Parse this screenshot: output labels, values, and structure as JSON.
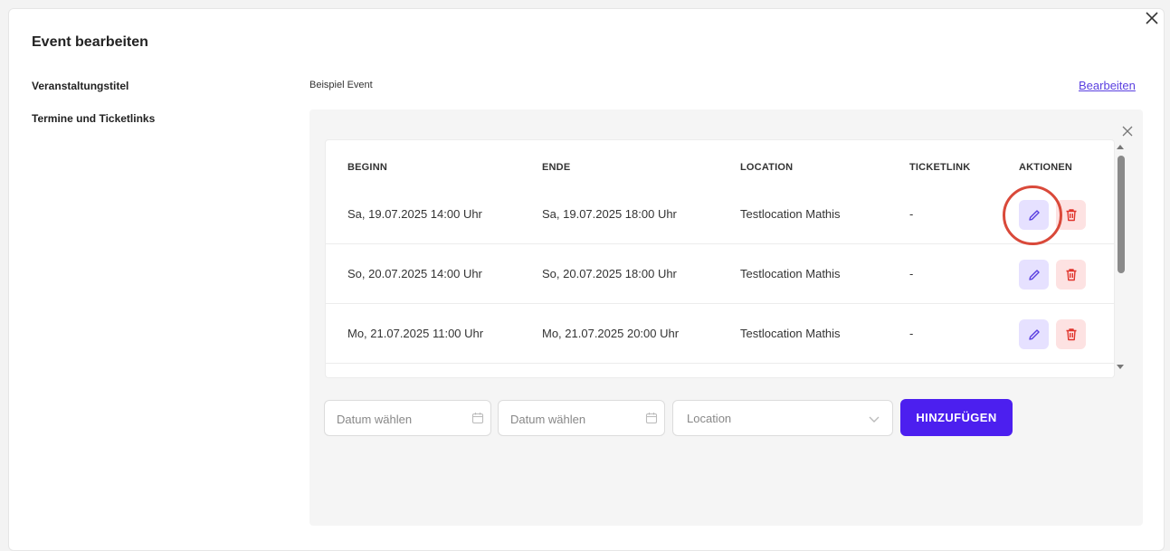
{
  "modal": {
    "title": "Event bearbeiten",
    "title_label": "Veranstaltungstitel",
    "title_value": "Beispiel Event",
    "edit_link": "Bearbeiten",
    "dates_label": "Termine und Ticketlinks"
  },
  "table": {
    "headers": [
      "BEGINN",
      "ENDE",
      "LOCATION",
      "TICKETLINK",
      "AKTIONEN"
    ],
    "rows": [
      {
        "start": "Sa, 19.07.2025 14:00 Uhr",
        "end": "Sa, 19.07.2025 18:00 Uhr",
        "location": "Testlocation Mathis",
        "ticketlink": "-"
      },
      {
        "start": "So, 20.07.2025 14:00 Uhr",
        "end": "So, 20.07.2025 18:00 Uhr",
        "location": "Testlocation Mathis",
        "ticketlink": "-"
      },
      {
        "start": "Mo, 21.07.2025 11:00 Uhr",
        "end": "Mo, 21.07.2025 20:00 Uhr",
        "location": "Testlocation Mathis",
        "ticketlink": "-"
      }
    ]
  },
  "form": {
    "start_placeholder": "Datum wählen",
    "end_placeholder": "Datum wählen",
    "location_placeholder": "Location",
    "add_button": "HINZUFÜGEN"
  },
  "icons": {
    "close": "close-icon",
    "edit": "pencil-icon",
    "delete": "trash-icon",
    "calendar": "calendar-icon",
    "dropdown": "chevron-down-icon"
  },
  "colors": {
    "accent": "#4c1fef",
    "link": "#5a3fe0",
    "edit_bg": "#e6e1ff",
    "delete_bg": "#fde2e2",
    "delete_icon": "#e0342c",
    "highlight": "#d9493a"
  }
}
